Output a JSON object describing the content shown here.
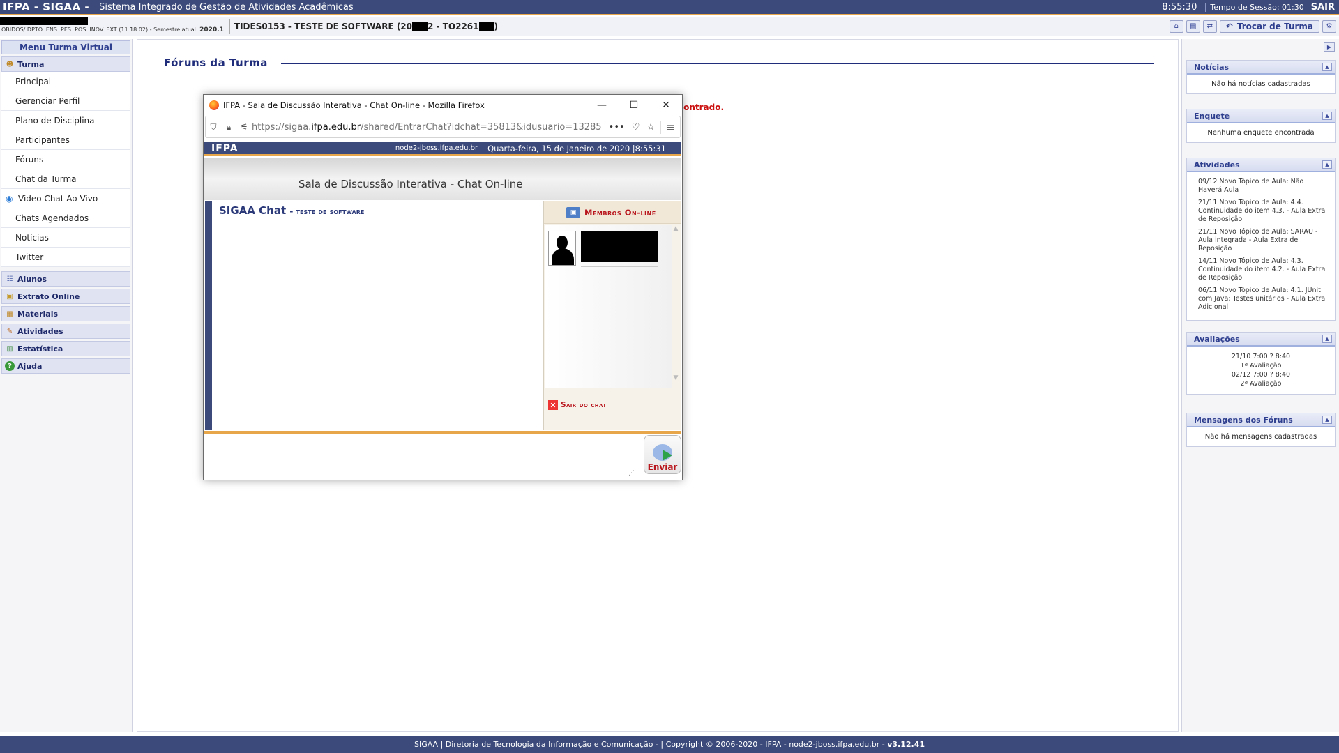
{
  "topbar": {
    "logo": "IFPA - SIGAA -",
    "subtitle": "Sistema Integrado de Gestão de Atividades Acadêmicas",
    "clock": "8:55:30",
    "session": "Tempo de Sessão: 01:30",
    "logout": "SAIR"
  },
  "infobar": {
    "department": "OBIDOS/ DPTO. ENS. PES. POS. INOV. EXT (11.18.02) - Semestre atual:",
    "semester": "2020.1",
    "course_prefix": "TIDES0153 - TESTE DE SOFTWARE (20",
    "course_mid": "2 - TO2261",
    "course_suffix": ")",
    "switch_class": "Trocar de Turma"
  },
  "leftmenu": {
    "title": "Menu Turma Virtual",
    "turma_label": "Turma",
    "turma_items": [
      "Principal",
      "Gerenciar Perfil",
      "Plano de Disciplina",
      "Participantes",
      "Fóruns",
      "Chat da Turma",
      "Video Chat Ao Vivo",
      "Chats Agendados",
      "Notícias",
      "Twitter"
    ],
    "sections": [
      "Alunos",
      "Extrato Online",
      "Materiais",
      "Atividades",
      "Estatística",
      "Ajuda"
    ]
  },
  "main": {
    "title": "Fóruns da Turma",
    "message": "contrado."
  },
  "right": {
    "noticias": {
      "title": "Notícias",
      "body": "Não há notícias cadastradas"
    },
    "enquete": {
      "title": "Enquete",
      "body": "Nenhuma enquete encontrada"
    },
    "atividades": {
      "title": "Atividades",
      "items": [
        "09/12 Novo Tópico de Aula: Não Haverá Aula",
        "21/11 Novo Tópico de Aula: 4.4. Continuidade do item 4.3. - Aula Extra de Reposição",
        "21/11 Novo Tópico de Aula: SARAU - Aula integrada - Aula Extra de Reposição",
        "14/11 Novo Tópico de Aula: 4.3. Continuidade do item 4.2. - Aula Extra de Reposição",
        "06/11 Novo Tópico de Aula: 4.1. JUnit com Java: Testes unitários - Aula Extra Adicional"
      ]
    },
    "avaliacoes": {
      "title": "Avaliações",
      "items": [
        {
          "time": "21/10 7:00 ? 8:40",
          "name": "1ª Avaliação"
        },
        {
          "time": "02/12 7:00 ? 8:40",
          "name": "2ª Avaliação"
        }
      ]
    },
    "mensagens": {
      "title": "Mensagens dos Fóruns",
      "body": "Não há mensagens cadastradas"
    }
  },
  "footer": {
    "text": "SIGAA | Diretoria de Tecnologia da Informação e Comunicação - | Copyright © 2006-2020 - IFPA - node2-jboss.ifpa.edu.br -",
    "version": "v3.12.41"
  },
  "popup": {
    "window_title": "IFPA - Sala de Discussão Interativa - Chat On-line - Mozilla Firefox",
    "url_prefix": "https://sigaa.",
    "url_host": "ifpa.edu.br",
    "url_path": "/shared/EntrarChat?idchat=35813&idusuario=13285",
    "header_logo": "IFPA",
    "header_node": "node2-jboss.ifpa.edu.br",
    "header_date": "Quarta-feira, 15 de Janeiro de 2020 |8:55:31",
    "banner": "Sala de Discussão Interativa  - Chat On-line",
    "chat_title": "SIGAA Chat",
    "chat_subject": "- teste de software",
    "members_title": "Membros On-line",
    "leave_chat": "Sair do chat",
    "send": "Enviar"
  }
}
